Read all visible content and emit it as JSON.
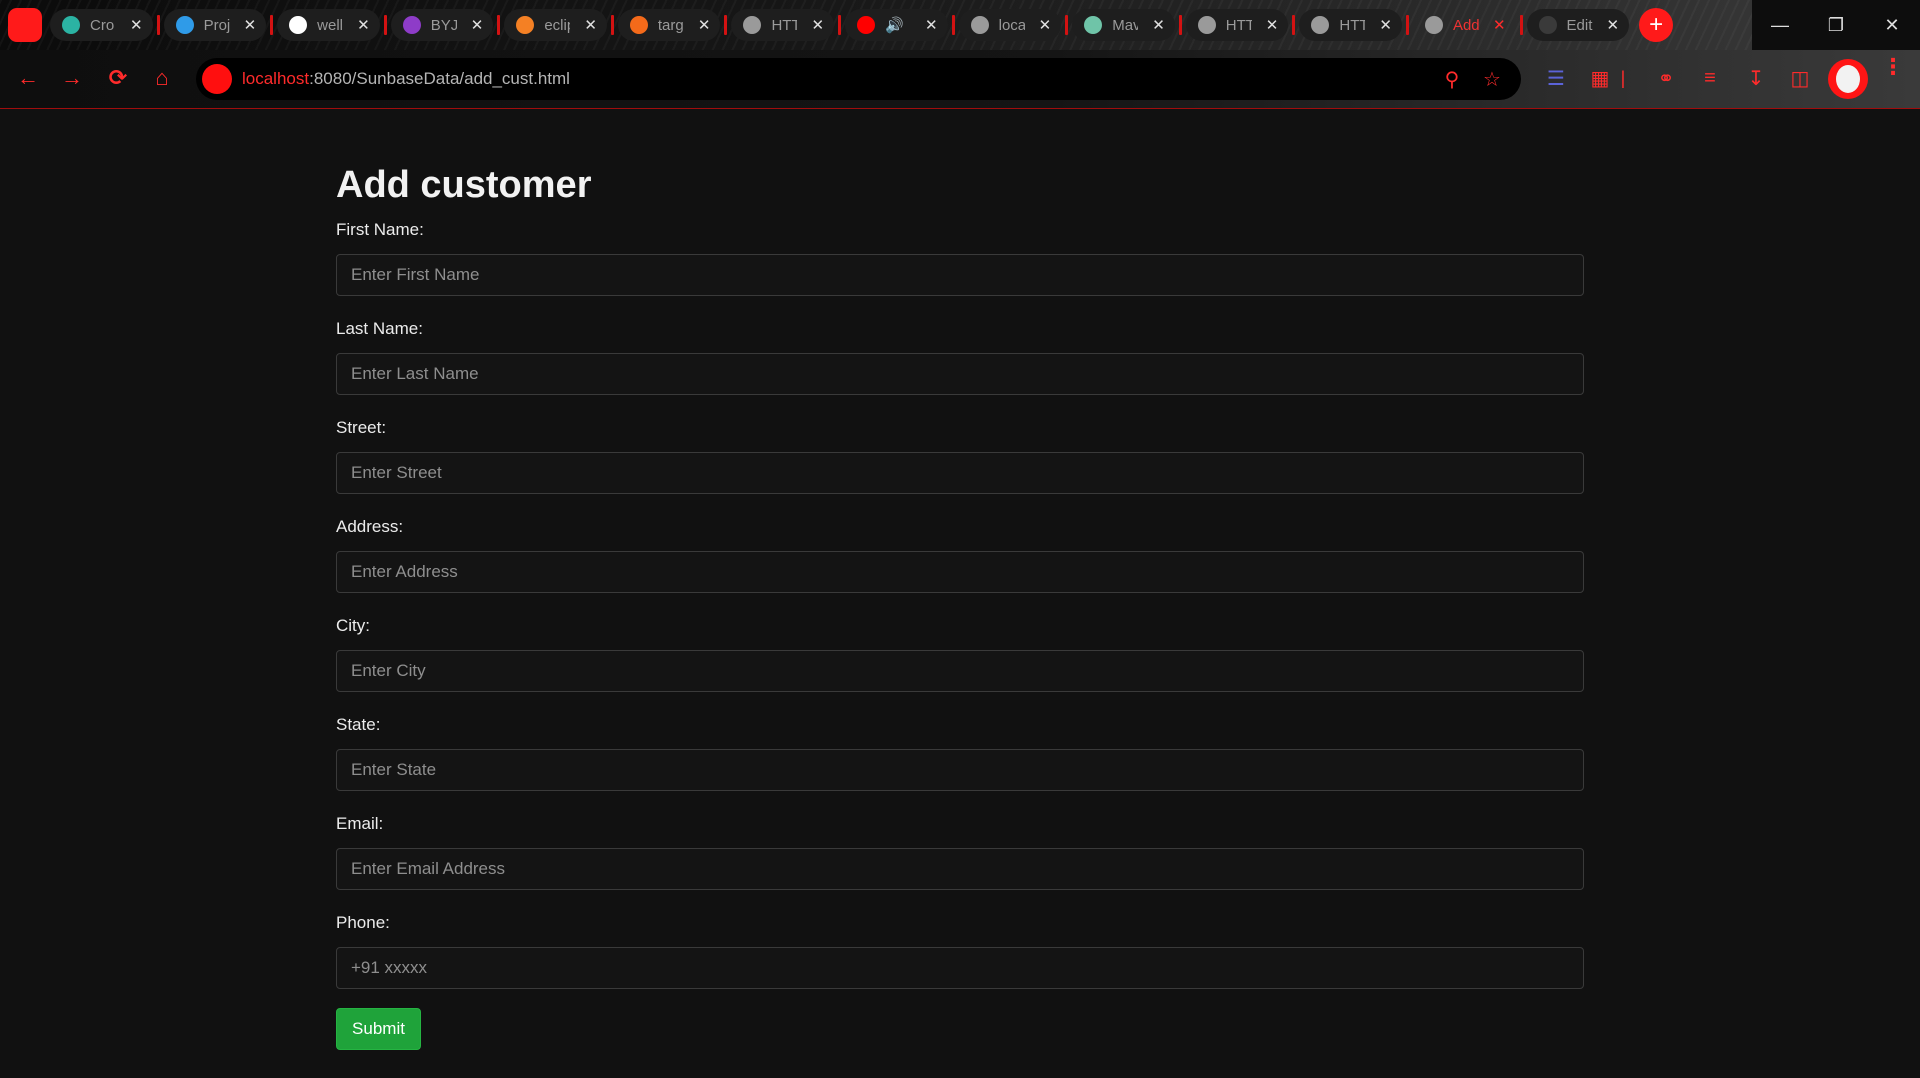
{
  "browser": {
    "tabs": [
      {
        "title": "Cro",
        "favicon": "crossed-circle-icon",
        "favicon_color": "#2bb3a3"
      },
      {
        "title": "Proj",
        "favicon": "bird-icon",
        "favicon_color": "#2f9be8"
      },
      {
        "title": "well",
        "favicon": "w-logo-icon",
        "favicon_color": "#ffffff"
      },
      {
        "title": "BYJU",
        "favicon": "byjus-icon",
        "favicon_color": "#8e3cc8"
      },
      {
        "title": "eclip",
        "favicon": "stackoverflow-icon",
        "favicon_color": "#f48024"
      },
      {
        "title": "targ",
        "favicon": "brave-icon",
        "favicon_color": "#f46a1a"
      },
      {
        "title": "HTT",
        "favicon": "globe-icon",
        "favicon_color": "#9a9a9a"
      },
      {
        "title": "",
        "favicon": "youtube-icon",
        "favicon_color": "#ff0000",
        "audio": true
      },
      {
        "title": "loca",
        "favicon": "globe-icon",
        "favicon_color": "#9a9a9a"
      },
      {
        "title": "Mav",
        "favicon": "chatgpt-icon",
        "favicon_color": "#6fc4a8"
      },
      {
        "title": "HTT",
        "favicon": "globe-icon",
        "favicon_color": "#9a9a9a"
      },
      {
        "title": "HTT",
        "favicon": "globe-icon",
        "favicon_color": "#9a9a9a"
      },
      {
        "title": "Add",
        "favicon": "globe-icon",
        "favicon_color": "#9a9a9a",
        "active": true
      },
      {
        "title": "Edit",
        "favicon": "github-icon",
        "favicon_color": "#3a3a3a"
      }
    ],
    "new_tab_label": "+",
    "address": {
      "host": "localhost",
      "rest": ":8080/SunbaseData/add_cust.html"
    },
    "accent": "#ff1a1a"
  },
  "form": {
    "title": "Add customer",
    "fields": [
      {
        "label": "First Name:",
        "placeholder": "Enter First Name"
      },
      {
        "label": "Last Name:",
        "placeholder": "Enter Last Name"
      },
      {
        "label": "Street:",
        "placeholder": "Enter Street"
      },
      {
        "label": "Address:",
        "placeholder": "Enter Address"
      },
      {
        "label": "City:",
        "placeholder": "Enter City"
      },
      {
        "label": "State:",
        "placeholder": "Enter State"
      },
      {
        "label": "Email:",
        "placeholder": "Enter Email Address"
      },
      {
        "label": "Phone:",
        "placeholder": "+91 xxxxx"
      }
    ],
    "submit_label": "Submit",
    "submit_color": "#1fa33a"
  }
}
